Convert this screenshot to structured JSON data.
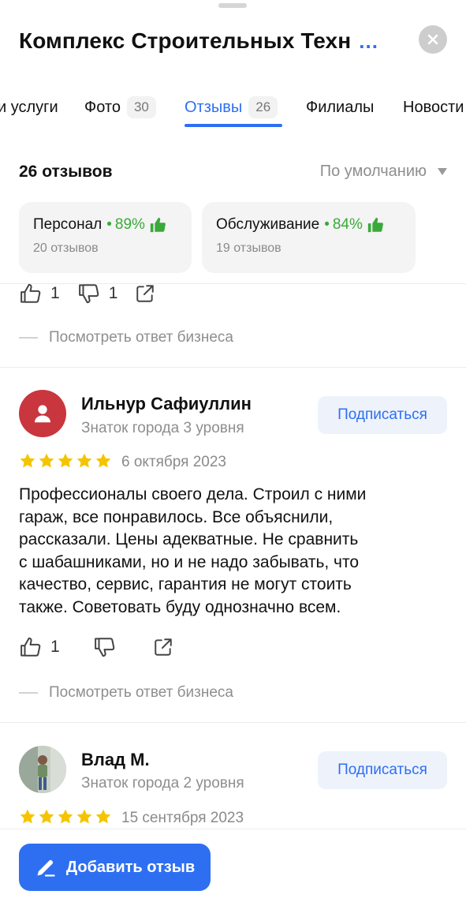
{
  "header": {
    "title": "Комплекс Строительных Техн",
    "more": "..."
  },
  "tabs": [
    {
      "label": "и услуги",
      "count": ""
    },
    {
      "label": "Фото",
      "count": "30"
    },
    {
      "label": "Отзывы",
      "count": "26"
    },
    {
      "label": "Филиалы",
      "count": ""
    },
    {
      "label": "Новости",
      "count": ""
    }
  ],
  "active_tab": "Отзывы",
  "summary": {
    "reviews_count": "26 отзывов",
    "sort_label": "По умолчанию"
  },
  "aspects": [
    {
      "name": "Персонал",
      "separator": "•",
      "percent": "89%",
      "reviews": "20 отзывов"
    },
    {
      "name": "Обслуживание",
      "separator": "•",
      "percent": "84%",
      "reviews": "19 отзывов"
    }
  ],
  "prev_review": {
    "likes": "1",
    "dislikes": "1",
    "business_reply": "Посмотреть ответ бизнеса"
  },
  "reviews": [
    {
      "author": "Ильнур Сафиуллин",
      "level": "Знаток города 3 уровня",
      "subscribe": "Подписаться",
      "rating": 5,
      "date": "6 октября 2023",
      "text_lines": [
        "Профессионалы своего дела. Строил с ними",
        "гараж, все понравилось. Все объяснили,",
        "рассказали. Цены адекватные. Не сравнить",
        "с шабашниками, но и не надо забывать, что",
        "качество, сервис, гарантия не могут стоить",
        "также. Советовать буду однозначно всем."
      ],
      "likes": "1",
      "dislikes": "",
      "business_reply": "Посмотреть ответ бизнеса",
      "avatar_color": "#c9363e"
    },
    {
      "author": "Влад М.",
      "level": "Знаток города 2 уровня",
      "subscribe": "Подписаться",
      "rating": 5,
      "date": "15 сентября 2023"
    }
  ],
  "add_review_button": "Добавить отзыв",
  "colors": {
    "accent": "#2e6ff2",
    "positive": "#3aa93a",
    "star": "#f5c400",
    "avatar": "#c9363e"
  },
  "icons": [
    "close-icon",
    "thumb-up-icon",
    "thumb-down-icon",
    "share-icon",
    "person-icon",
    "star-icon",
    "pencil-icon",
    "sort-triangle-icon"
  ]
}
